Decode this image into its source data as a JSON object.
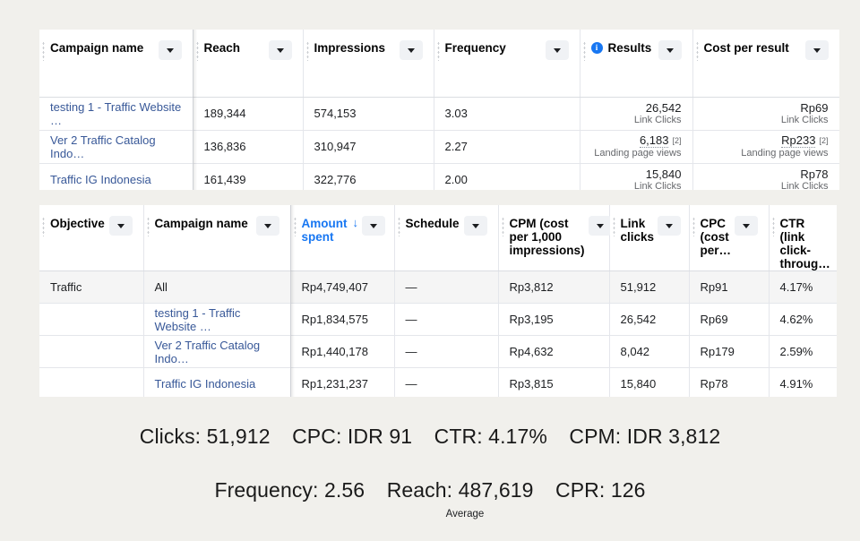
{
  "colors": {
    "page_background": "#f1f0ec",
    "link": "#385898",
    "accent_blue": "#1877f2",
    "summary_row": "#f5f5f5",
    "border": "#e4e6eb"
  },
  "campaign_table": {
    "name": "campaign-performance-table",
    "columns": [
      {
        "label": "Campaign name",
        "icon": null,
        "has_menu": true
      },
      {
        "label": "Reach",
        "icon": null,
        "has_menu": true
      },
      {
        "label": "Impressions",
        "icon": null,
        "has_menu": true
      },
      {
        "label": "Frequency",
        "icon": null,
        "has_menu": true
      },
      {
        "label": "Results",
        "icon": "info-icon",
        "has_menu": true
      },
      {
        "label": "Cost per result",
        "icon": null,
        "has_menu": true
      }
    ],
    "rows": [
      {
        "campaign_name": "testing 1 - Traffic Website …",
        "reach": "189,344",
        "impressions": "574,153",
        "frequency": "3.03",
        "results_value": "26,542",
        "results_label": "Link Clicks",
        "results_footnote": "",
        "cost_per_result_value": "Rp69",
        "cost_per_result_label": "Link Clicks",
        "cost_per_result_footnote": ""
      },
      {
        "campaign_name": "Ver 2 Traffic Catalog Indo…",
        "reach": "136,836",
        "impressions": "310,947",
        "frequency": "2.27",
        "results_value": "6,183",
        "results_label": "Landing page views",
        "results_footnote": "[2]",
        "cost_per_result_value": "Rp233",
        "cost_per_result_label": "Landing page views",
        "cost_per_result_footnote": "[2]"
      },
      {
        "campaign_name": "Traffic IG Indonesia",
        "reach": "161,439",
        "impressions": "322,776",
        "frequency": "2.00",
        "results_value": "15,840",
        "results_label": "Link Clicks",
        "results_footnote": "",
        "cost_per_result_value": "Rp78",
        "cost_per_result_label": "Link Clicks",
        "cost_per_result_footnote": ""
      }
    ]
  },
  "breakdown_table": {
    "name": "campaign-breakdown-table",
    "columns": [
      {
        "label": "Objective",
        "sorted": false,
        "has_menu": true
      },
      {
        "label": "Campaign name",
        "sorted": false,
        "has_menu": true
      },
      {
        "label": "Amount spent",
        "sorted": true,
        "sort_direction": "desc",
        "has_menu": true
      },
      {
        "label": "Schedule",
        "sorted": false,
        "has_menu": true
      },
      {
        "label": "CPM (cost per 1,000 impressions)",
        "sorted": false,
        "has_menu": true
      },
      {
        "label": "Link clicks",
        "sorted": false,
        "has_menu": true
      },
      {
        "label": "CPC (cost per…",
        "sorted": false,
        "has_menu": true
      },
      {
        "label": "CTR (link click-throug…",
        "sorted": false,
        "has_menu": false
      }
    ],
    "summary_row": {
      "objective": "Traffic",
      "campaign_name": "All",
      "amount_spent": "Rp4,749,407",
      "schedule": "—",
      "cpm": "Rp3,812",
      "link_clicks": "51,912",
      "cpc": "Rp91",
      "ctr": "4.17%"
    },
    "rows": [
      {
        "objective": "",
        "campaign_name": "testing 1 - Traffic Website …",
        "amount_spent": "Rp1,834,575",
        "schedule": "—",
        "cpm": "Rp3,195",
        "link_clicks": "26,542",
        "cpc": "Rp69",
        "ctr": "4.62%"
      },
      {
        "objective": "",
        "campaign_name": "Ver 2 Traffic Catalog Indo…",
        "amount_spent": "Rp1,440,178",
        "schedule": "—",
        "cpm": "Rp4,632",
        "link_clicks": "8,042",
        "cpc": "Rp179",
        "ctr": "2.59%"
      },
      {
        "objective": "",
        "campaign_name": "Traffic IG Indonesia",
        "amount_spent": "Rp1,231,237",
        "schedule": "—",
        "cpm": "Rp3,815",
        "link_clicks": "15,840",
        "cpc": "Rp78",
        "ctr": "4.91%"
      }
    ]
  },
  "summary": {
    "line1": [
      "Clicks: 51,912",
      "CPC: IDR 91",
      "CTR: 4.17%",
      "CPM: IDR 3,812"
    ],
    "line2": [
      "Frequency: 2.56",
      "Reach: 487,619",
      "CPR: 126"
    ],
    "note": "Average"
  }
}
